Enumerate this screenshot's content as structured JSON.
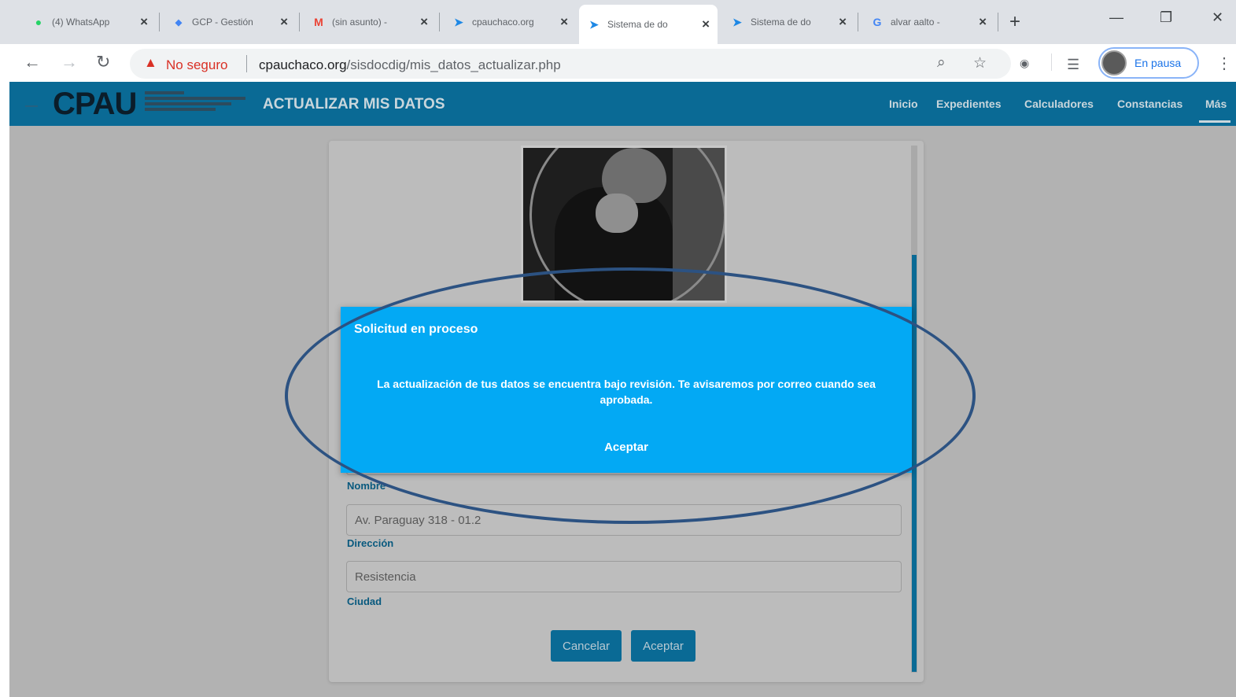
{
  "browser": {
    "tabs": [
      {
        "title": "(4) WhatsApp",
        "icon": "whatsapp-icon"
      },
      {
        "title": "GCP - Gestión",
        "icon": "gcp-icon"
      },
      {
        "title": "(sin asunto) - ",
        "icon": "gmail-icon"
      },
      {
        "title": "cpauchaco.org",
        "icon": "cpau-icon"
      },
      {
        "title": "Sistema de do",
        "icon": "cpau-icon",
        "active": true
      },
      {
        "title": "Sistema de do",
        "icon": "cpau-icon"
      },
      {
        "title": "alvar aalto - ",
        "icon": "google-icon"
      }
    ],
    "security_text": "No seguro",
    "url_domain": "cpauchaco.org",
    "url_path": "/sisdocdig/mis_datos_actualizar.php",
    "profile_status": "En pausa"
  },
  "site": {
    "logo": "CPAU",
    "page_title": "ACTUALIZAR MIS DATOS",
    "nav": [
      "Inicio",
      "Expedientes",
      "Calculadores",
      "Constancias",
      "Más"
    ]
  },
  "form": {
    "fields": [
      {
        "label": "Nombre",
        "value": ""
      },
      {
        "label": "Dirección",
        "value": "Av. Paraguay 318 - 01.2"
      },
      {
        "label": "Ciudad",
        "value": "Resistencia"
      }
    ],
    "cancel_label": "Cancelar",
    "submit_label": "Aceptar"
  },
  "modal": {
    "title": "Solicitud en proceso",
    "message": "La actualización de tus datos se encuentra bajo revisión. Te avisaremos por correo cuando sea aprobada.",
    "ok_label": "Aceptar"
  },
  "colors": {
    "header": "#0a6a95",
    "modal": "#03a9f4",
    "annotation": "#2c5282"
  }
}
